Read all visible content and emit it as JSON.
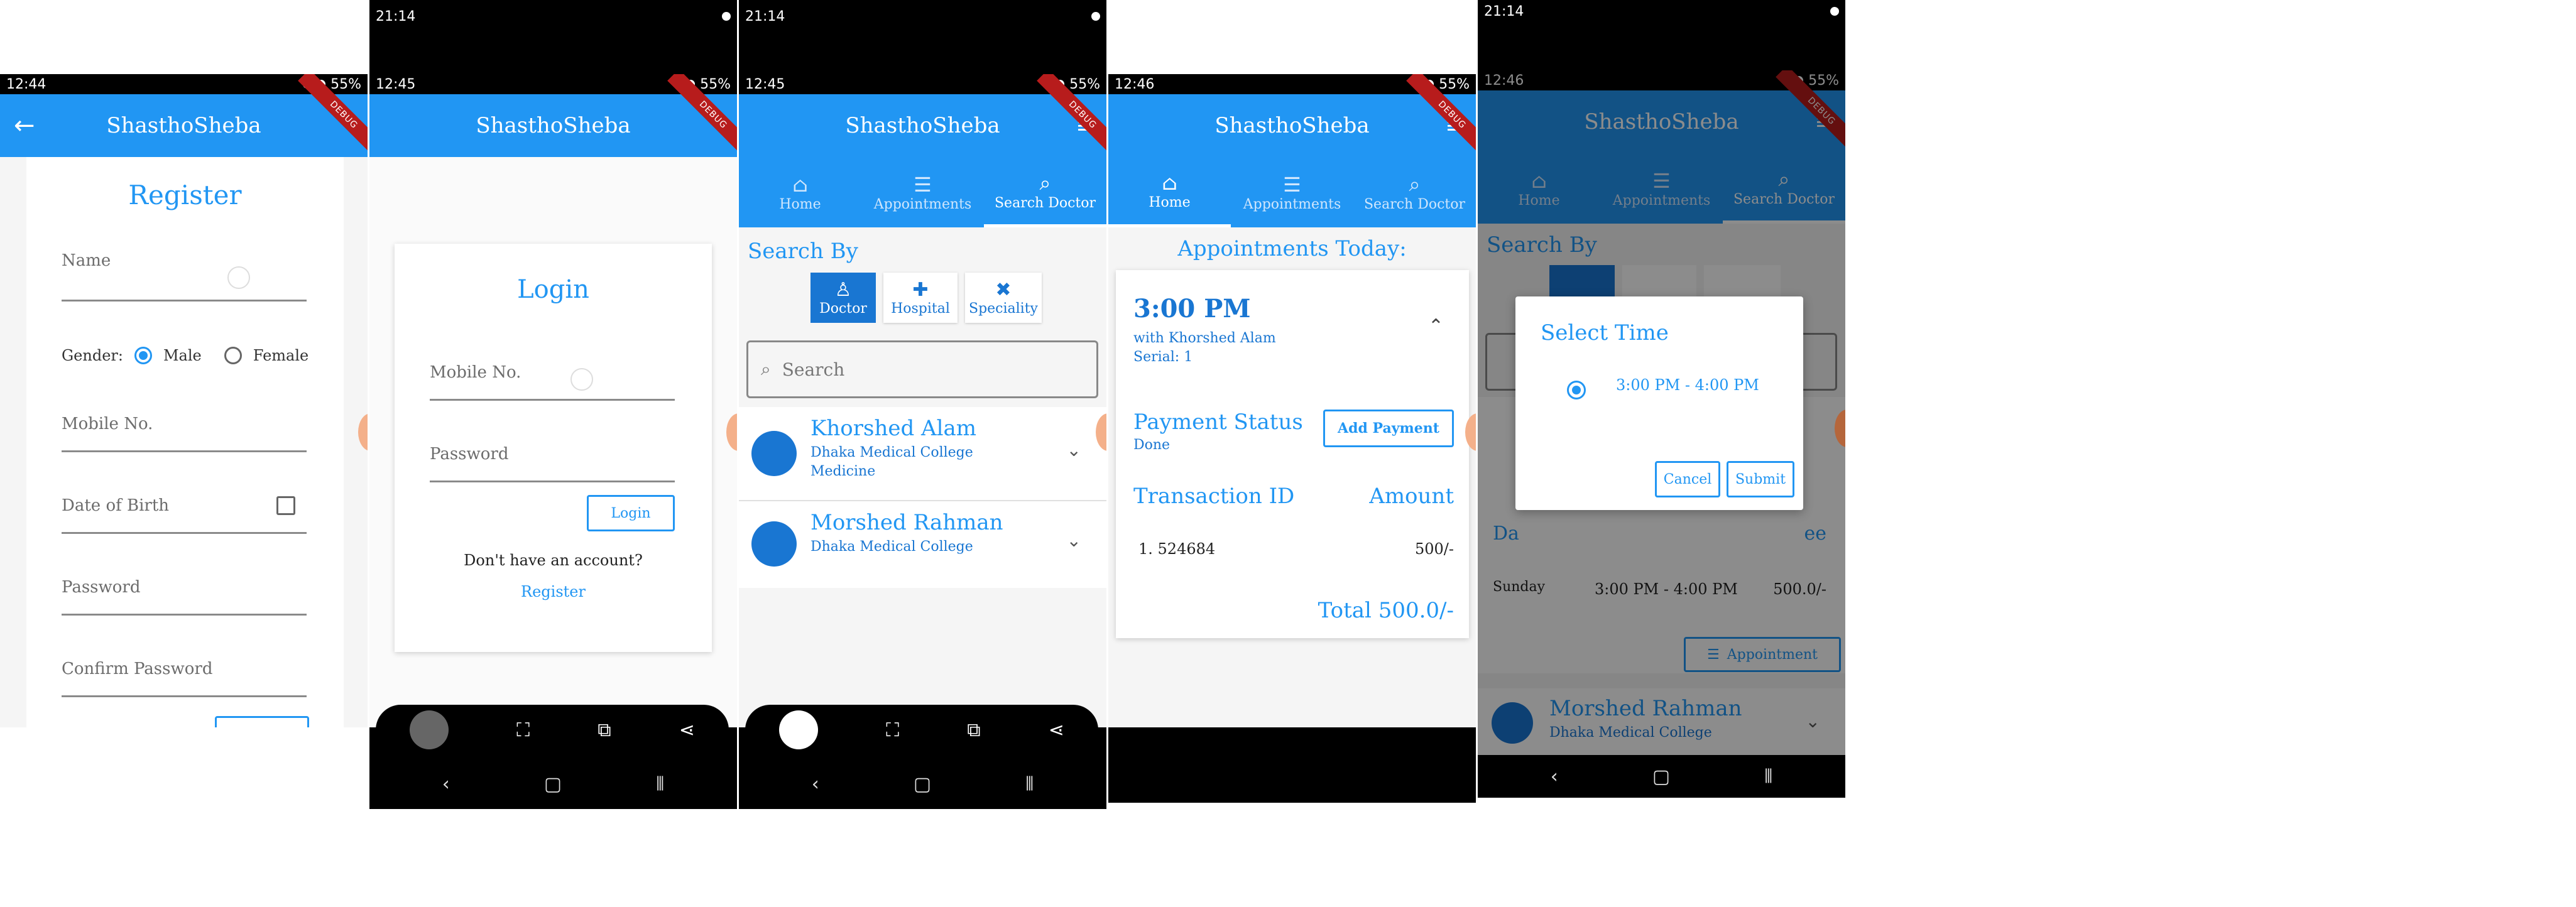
{
  "app_title": "ShasthoSheba",
  "colors": {
    "primary": "#2196f3",
    "dark_primary": "#1976d2",
    "debug_banner": "#b71c1c"
  },
  "debug_label": "DEBUG",
  "screens": {
    "register": {
      "status_time": "12:44",
      "battery": "55%",
      "heading": "Register",
      "name_placeholder": "Name",
      "gender_label": "Gender:",
      "male": "Male",
      "female": "Female",
      "mobile_placeholder": "Mobile No.",
      "dob_placeholder": "Date of Birth",
      "password_placeholder": "Password",
      "confirm_placeholder": "Confirm Password"
    },
    "login": {
      "top_time": "21:14",
      "status_time": "12:45",
      "battery": "55%",
      "heading": "Login",
      "mobile_placeholder": "Mobile No.",
      "password_placeholder": "Password",
      "login_button": "Login",
      "no_account": "Don't have an account?",
      "register_link": "Register"
    },
    "search": {
      "top_time": "21:14",
      "status_time": "12:45",
      "battery": "55%",
      "tabs": [
        "Home",
        "Appointments",
        "Search Doctor"
      ],
      "search_by": "Search By",
      "filters": [
        "Doctor",
        "Hospital",
        "Speciality"
      ],
      "search_placeholder": "Search",
      "doctors": [
        {
          "name": "Khorshed Alam",
          "hospital": "Dhaka Medical College",
          "speciality": "Medicine"
        },
        {
          "name": "Morshed Rahman",
          "hospital": "Dhaka Medical College",
          "speciality": ""
        }
      ]
    },
    "appointments": {
      "status_time": "12:46",
      "battery": "55%",
      "tabs": [
        "Home",
        "Appointments",
        "Search Doctor"
      ],
      "title": "Appointments Today:",
      "time": "3:00 PM",
      "with_doctor": "with Khorshed Alam",
      "serial": "Serial: 1",
      "payment_status_label": "Payment Status",
      "payment_status_value": "Done",
      "add_payment": "Add Payment",
      "transaction_id_label": "Transaction ID",
      "amount_label": "Amount",
      "transaction_row": "1. 524684",
      "transaction_amount": "500/-",
      "total": "Total 500.0/-"
    },
    "select_time": {
      "top_time": "21:14",
      "status_time": "12:46",
      "battery": "55%",
      "tabs": [
        "Home",
        "Appointments",
        "Search Doctor"
      ],
      "search_by": "Search By",
      "dialog_title": "Select Time",
      "option": "3:00 PM - 4:00 PM",
      "cancel": "Cancel",
      "submit": "Submit",
      "bg_day_header": "Da",
      "bg_fee_header": "ee",
      "bg_day": "Sunday",
      "bg_time": "3:00 PM - 4:00 PM",
      "bg_fee": "500.0/-",
      "appointment_button": "Appointment",
      "doctor_name": "Morshed Rahman",
      "doctor_hospital": "Dhaka Medical College"
    }
  }
}
